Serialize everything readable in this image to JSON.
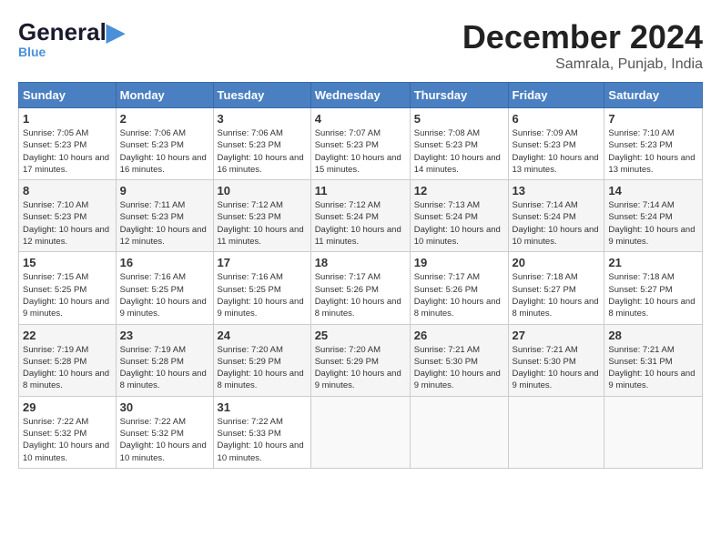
{
  "header": {
    "logo_general": "General",
    "logo_blue": "Blue",
    "month_title": "December 2024",
    "location": "Samrala, Punjab, India"
  },
  "days_of_week": [
    "Sunday",
    "Monday",
    "Tuesday",
    "Wednesday",
    "Thursday",
    "Friday",
    "Saturday"
  ],
  "weeks": [
    [
      {
        "day": "1",
        "sunrise": "Sunrise: 7:05 AM",
        "sunset": "Sunset: 5:23 PM",
        "daylight": "Daylight: 10 hours and 17 minutes."
      },
      {
        "day": "2",
        "sunrise": "Sunrise: 7:06 AM",
        "sunset": "Sunset: 5:23 PM",
        "daylight": "Daylight: 10 hours and 16 minutes."
      },
      {
        "day": "3",
        "sunrise": "Sunrise: 7:06 AM",
        "sunset": "Sunset: 5:23 PM",
        "daylight": "Daylight: 10 hours and 16 minutes."
      },
      {
        "day": "4",
        "sunrise": "Sunrise: 7:07 AM",
        "sunset": "Sunset: 5:23 PM",
        "daylight": "Daylight: 10 hours and 15 minutes."
      },
      {
        "day": "5",
        "sunrise": "Sunrise: 7:08 AM",
        "sunset": "Sunset: 5:23 PM",
        "daylight": "Daylight: 10 hours and 14 minutes."
      },
      {
        "day": "6",
        "sunrise": "Sunrise: 7:09 AM",
        "sunset": "Sunset: 5:23 PM",
        "daylight": "Daylight: 10 hours and 13 minutes."
      },
      {
        "day": "7",
        "sunrise": "Sunrise: 7:10 AM",
        "sunset": "Sunset: 5:23 PM",
        "daylight": "Daylight: 10 hours and 13 minutes."
      }
    ],
    [
      {
        "day": "8",
        "sunrise": "Sunrise: 7:10 AM",
        "sunset": "Sunset: 5:23 PM",
        "daylight": "Daylight: 10 hours and 12 minutes."
      },
      {
        "day": "9",
        "sunrise": "Sunrise: 7:11 AM",
        "sunset": "Sunset: 5:23 PM",
        "daylight": "Daylight: 10 hours and 12 minutes."
      },
      {
        "day": "10",
        "sunrise": "Sunrise: 7:12 AM",
        "sunset": "Sunset: 5:23 PM",
        "daylight": "Daylight: 10 hours and 11 minutes."
      },
      {
        "day": "11",
        "sunrise": "Sunrise: 7:12 AM",
        "sunset": "Sunset: 5:24 PM",
        "daylight": "Daylight: 10 hours and 11 minutes."
      },
      {
        "day": "12",
        "sunrise": "Sunrise: 7:13 AM",
        "sunset": "Sunset: 5:24 PM",
        "daylight": "Daylight: 10 hours and 10 minutes."
      },
      {
        "day": "13",
        "sunrise": "Sunrise: 7:14 AM",
        "sunset": "Sunset: 5:24 PM",
        "daylight": "Daylight: 10 hours and 10 minutes."
      },
      {
        "day": "14",
        "sunrise": "Sunrise: 7:14 AM",
        "sunset": "Sunset: 5:24 PM",
        "daylight": "Daylight: 10 hours and 9 minutes."
      }
    ],
    [
      {
        "day": "15",
        "sunrise": "Sunrise: 7:15 AM",
        "sunset": "Sunset: 5:25 PM",
        "daylight": "Daylight: 10 hours and 9 minutes."
      },
      {
        "day": "16",
        "sunrise": "Sunrise: 7:16 AM",
        "sunset": "Sunset: 5:25 PM",
        "daylight": "Daylight: 10 hours and 9 minutes."
      },
      {
        "day": "17",
        "sunrise": "Sunrise: 7:16 AM",
        "sunset": "Sunset: 5:25 PM",
        "daylight": "Daylight: 10 hours and 9 minutes."
      },
      {
        "day": "18",
        "sunrise": "Sunrise: 7:17 AM",
        "sunset": "Sunset: 5:26 PM",
        "daylight": "Daylight: 10 hours and 8 minutes."
      },
      {
        "day": "19",
        "sunrise": "Sunrise: 7:17 AM",
        "sunset": "Sunset: 5:26 PM",
        "daylight": "Daylight: 10 hours and 8 minutes."
      },
      {
        "day": "20",
        "sunrise": "Sunrise: 7:18 AM",
        "sunset": "Sunset: 5:27 PM",
        "daylight": "Daylight: 10 hours and 8 minutes."
      },
      {
        "day": "21",
        "sunrise": "Sunrise: 7:18 AM",
        "sunset": "Sunset: 5:27 PM",
        "daylight": "Daylight: 10 hours and 8 minutes."
      }
    ],
    [
      {
        "day": "22",
        "sunrise": "Sunrise: 7:19 AM",
        "sunset": "Sunset: 5:28 PM",
        "daylight": "Daylight: 10 hours and 8 minutes."
      },
      {
        "day": "23",
        "sunrise": "Sunrise: 7:19 AM",
        "sunset": "Sunset: 5:28 PM",
        "daylight": "Daylight: 10 hours and 8 minutes."
      },
      {
        "day": "24",
        "sunrise": "Sunrise: 7:20 AM",
        "sunset": "Sunset: 5:29 PM",
        "daylight": "Daylight: 10 hours and 8 minutes."
      },
      {
        "day": "25",
        "sunrise": "Sunrise: 7:20 AM",
        "sunset": "Sunset: 5:29 PM",
        "daylight": "Daylight: 10 hours and 9 minutes."
      },
      {
        "day": "26",
        "sunrise": "Sunrise: 7:21 AM",
        "sunset": "Sunset: 5:30 PM",
        "daylight": "Daylight: 10 hours and 9 minutes."
      },
      {
        "day": "27",
        "sunrise": "Sunrise: 7:21 AM",
        "sunset": "Sunset: 5:30 PM",
        "daylight": "Daylight: 10 hours and 9 minutes."
      },
      {
        "day": "28",
        "sunrise": "Sunrise: 7:21 AM",
        "sunset": "Sunset: 5:31 PM",
        "daylight": "Daylight: 10 hours and 9 minutes."
      }
    ],
    [
      {
        "day": "29",
        "sunrise": "Sunrise: 7:22 AM",
        "sunset": "Sunset: 5:32 PM",
        "daylight": "Daylight: 10 hours and 10 minutes."
      },
      {
        "day": "30",
        "sunrise": "Sunrise: 7:22 AM",
        "sunset": "Sunset: 5:32 PM",
        "daylight": "Daylight: 10 hours and 10 minutes."
      },
      {
        "day": "31",
        "sunrise": "Sunrise: 7:22 AM",
        "sunset": "Sunset: 5:33 PM",
        "daylight": "Daylight: 10 hours and 10 minutes."
      },
      null,
      null,
      null,
      null
    ]
  ]
}
